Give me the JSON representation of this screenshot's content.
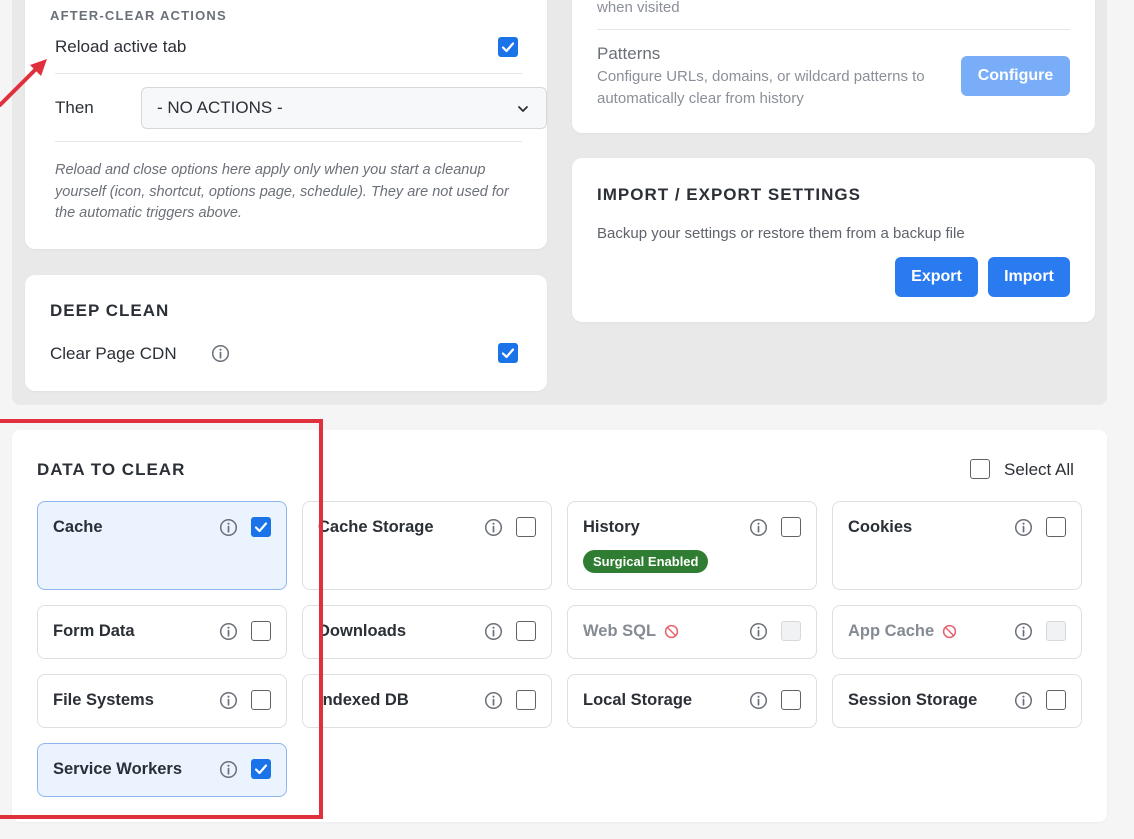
{
  "after_clear": {
    "heading": "AFTER-CLEAR ACTIONS",
    "reload_label": "Reload active tab",
    "reload_checked": true,
    "then_label": "Then",
    "then_value": "- NO ACTIONS -",
    "note": "Reload and close options here apply only when you start a cleanup yourself (icon, shortcut, options page, schedule). They are not used for the automatic triggers above."
  },
  "deep_clean": {
    "title": "DEEP CLEAN",
    "clear_cdn_label": "Clear Page CDN",
    "clear_cdn_checked": true
  },
  "history_card": {
    "visited_text": "when visited",
    "patterns_title": "Patterns",
    "patterns_desc": "Configure URLs, domains, or wildcard patterns to automatically clear from history",
    "configure_label": "Configure"
  },
  "import_export": {
    "title": "IMPORT / EXPORT SETTINGS",
    "desc": "Backup your settings or restore them from a backup file",
    "export_label": "Export",
    "import_label": "Import"
  },
  "data_to_clear": {
    "title": "DATA TO CLEAR",
    "select_all_label": "Select All",
    "items": [
      {
        "label": "Cache",
        "checked": true,
        "selected": true,
        "disabled": false
      },
      {
        "label": "Cache Storage",
        "checked": false,
        "selected": false,
        "disabled": false
      },
      {
        "label": "History",
        "checked": false,
        "selected": false,
        "disabled": false,
        "badge": "Surgical Enabled"
      },
      {
        "label": "Cookies",
        "checked": false,
        "selected": false,
        "disabled": false
      },
      {
        "label": "Form Data",
        "checked": false,
        "selected": false,
        "disabled": false
      },
      {
        "label": "Downloads",
        "checked": false,
        "selected": false,
        "disabled": false
      },
      {
        "label": "Web SQL",
        "checked": false,
        "selected": false,
        "disabled": true
      },
      {
        "label": "App Cache",
        "checked": false,
        "selected": false,
        "disabled": true
      },
      {
        "label": "File Systems",
        "checked": false,
        "selected": false,
        "disabled": false
      },
      {
        "label": "Indexed DB",
        "checked": false,
        "selected": false,
        "disabled": false
      },
      {
        "label": "Local Storage",
        "checked": false,
        "selected": false,
        "disabled": false
      },
      {
        "label": "Session Storage",
        "checked": false,
        "selected": false,
        "disabled": false
      },
      {
        "label": "Service Workers",
        "checked": true,
        "selected": true,
        "disabled": false
      }
    ]
  },
  "colors": {
    "accent": "#1a73e8",
    "button": "#2b7bf0",
    "badge": "#2e7d32",
    "annotation": "#e0303e"
  }
}
